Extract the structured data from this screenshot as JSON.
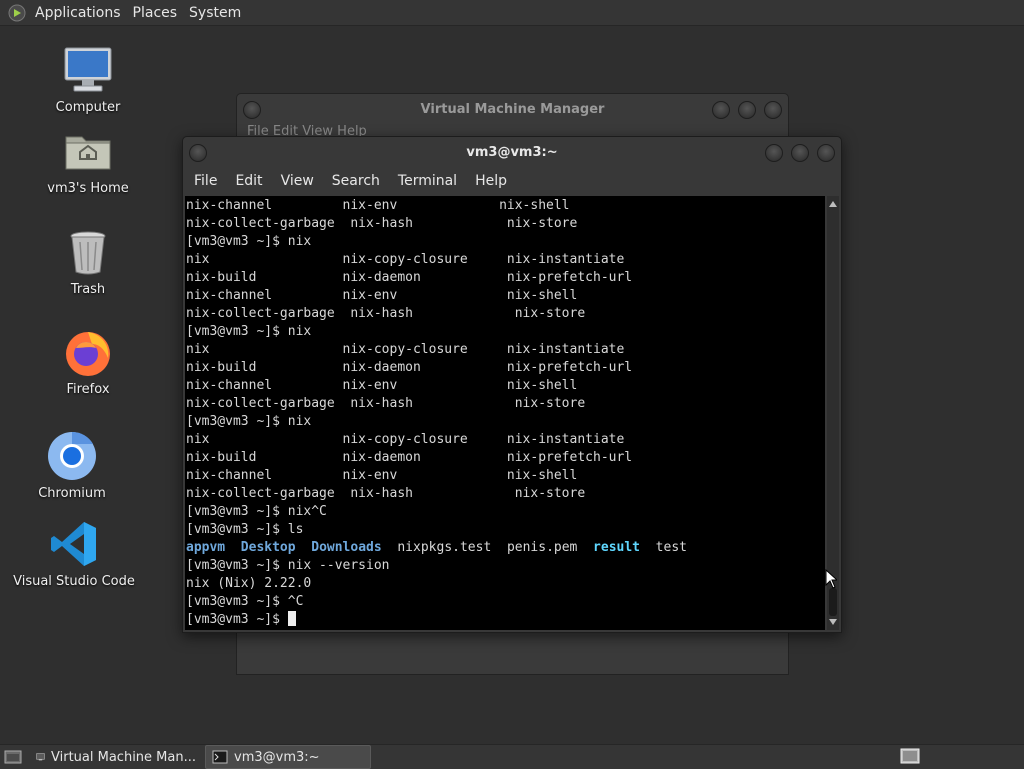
{
  "top_panel": {
    "menus": [
      "Applications",
      "Places",
      "System"
    ]
  },
  "desktop_icons": [
    {
      "label": "Computer",
      "icon": "computer-icon"
    },
    {
      "label": "vm3's Home",
      "icon": "home-folder-icon"
    },
    {
      "label": "Trash",
      "icon": "trash-icon"
    },
    {
      "label": "Firefox",
      "icon": "firefox-icon"
    },
    {
      "label": "Chromium",
      "icon": "chromium-icon"
    },
    {
      "label": "Visual Studio Code",
      "icon": "vscode-icon"
    }
  ],
  "vmm_window": {
    "title": "Virtual Machine Manager",
    "menus_partial": "File  Edit  View  Help"
  },
  "terminal": {
    "title": "vm3@vm3:~",
    "menus": [
      "File",
      "Edit",
      "View",
      "Search",
      "Terminal",
      "Help"
    ],
    "lines": [
      "nix-channel         nix-env             nix-shell",
      "nix-collect-garbage  nix-hash            nix-store",
      "[vm3@vm3 ~]$ nix",
      "nix                 nix-copy-closure     nix-instantiate",
      "nix-build           nix-daemon           nix-prefetch-url",
      "nix-channel         nix-env              nix-shell",
      "nix-collect-garbage  nix-hash             nix-store",
      "[vm3@vm3 ~]$ nix",
      "nix                 nix-copy-closure     nix-instantiate",
      "nix-build           nix-daemon           nix-prefetch-url",
      "nix-channel         nix-env              nix-shell",
      "nix-collect-garbage  nix-hash             nix-store",
      "[vm3@vm3 ~]$ nix",
      "nix                 nix-copy-closure     nix-instantiate",
      "nix-build           nix-daemon           nix-prefetch-url",
      "nix-channel         nix-env              nix-shell",
      "nix-collect-garbage  nix-hash             nix-store",
      "[vm3@vm3 ~]$ nix^C",
      "[vm3@vm3 ~]$ ls"
    ],
    "ls_output": {
      "dirs": [
        "appvm",
        "Desktop",
        "Downloads"
      ],
      "files": [
        "nixpkgs.test",
        "penis.pem"
      ],
      "links": [
        "result"
      ],
      "last_file": "test"
    },
    "after_lines": [
      "[vm3@vm3 ~]$ nix --version",
      "nix (Nix) 2.22.0",
      "[vm3@vm3 ~]$ ^C"
    ],
    "prompt": "[vm3@vm3 ~]$ "
  },
  "taskbar": {
    "tasks": [
      {
        "label": "Virtual Machine Man...",
        "active": false
      },
      {
        "label": "vm3@vm3:~",
        "active": true
      }
    ]
  },
  "colors": {
    "desktop_bg": "#2f2f2f",
    "panel_bg": "#353535",
    "terminal_bg": "#000000",
    "ls_dir": "#6fa8dc",
    "ls_link": "#5fd7ff"
  }
}
